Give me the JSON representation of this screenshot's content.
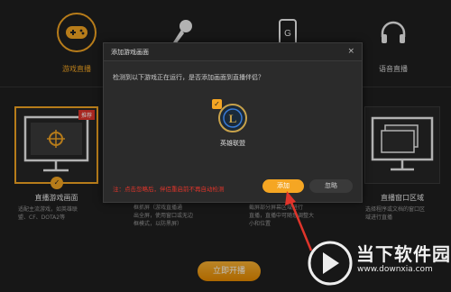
{
  "top_tabs": [
    {
      "label": "游戏直播",
      "icon": "gamepad-icon",
      "active": true
    },
    {
      "label": "",
      "icon": "microphone-icon",
      "active": false
    },
    {
      "label": "",
      "icon": "phone-icon",
      "active": false
    },
    {
      "label": "语音直播",
      "icon": "headphones-icon",
      "active": false
    }
  ],
  "cards": {
    "game": {
      "title": "直播游戏画面",
      "desc_1": "适配主流游戏，如英雄联",
      "desc_2": "盟、CF、DOTA2等",
      "badge": "推荐"
    },
    "middle": {
      "desc_1": "框抓屏（游戏直播通",
      "desc_2": "出全屏，使用窗口或无边",
      "desc_3": "框模式，以防黑屏）"
    },
    "right_middle": {
      "desc_1": "截屏部分屏幕区域进行",
      "desc_2": "直播，直播中可随意调整大",
      "desc_3": "小和位置"
    },
    "window": {
      "title": "直播窗口区域",
      "desc_1": "选择程序或文档的窗口区",
      "desc_2": "域进行直播"
    }
  },
  "dialog": {
    "title": "添加游戏画面",
    "close": "×",
    "question": "检测到以下游戏正在运行，是否添加画面到直播伴侣？",
    "game_name": "英雄联盟",
    "note": "注：点击忽略后，伴侣重启前不再自动检测",
    "add_label": "添加",
    "ignore_label": "忽略"
  },
  "start_button": "立即开播",
  "watermark": {
    "title": "当下软件园",
    "url": "www.downxia.com"
  },
  "colors": {
    "accent": "#f5a623",
    "danger": "#e0352b",
    "background": "#1f1f1f"
  }
}
